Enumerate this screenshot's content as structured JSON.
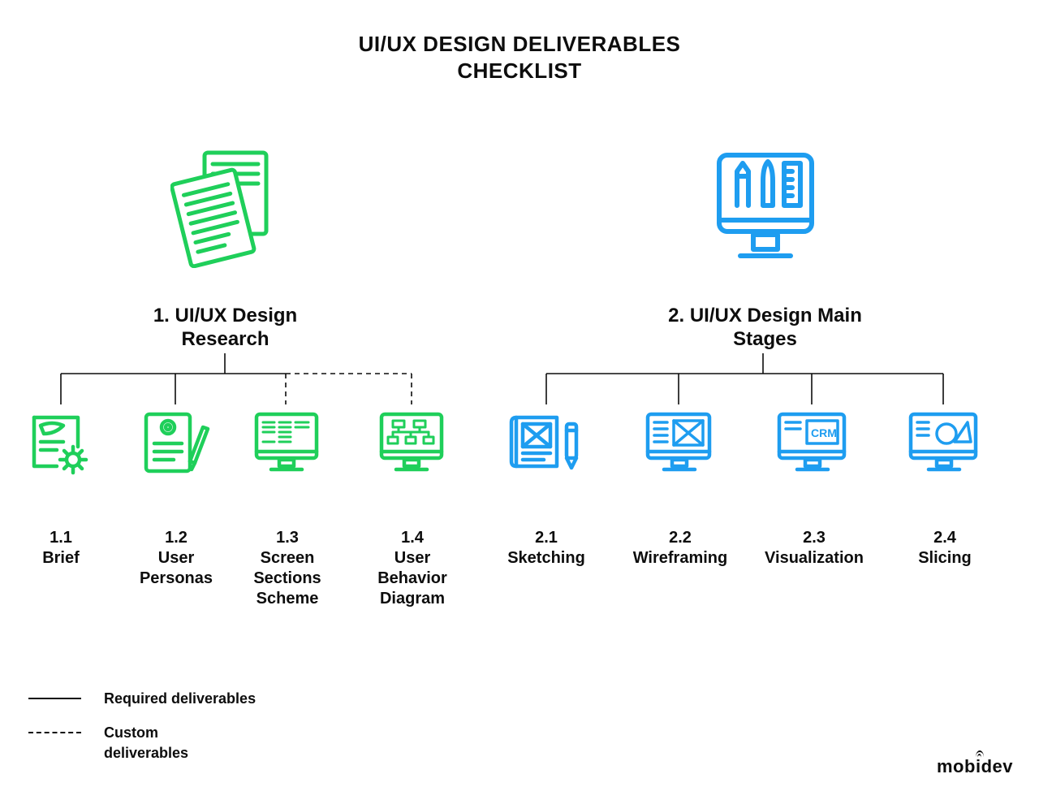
{
  "title_line1": "UI/UX DESIGN DELIVERABLES",
  "title_line2": "CHECKLIST",
  "legend": {
    "required": "Required deliverables",
    "custom_line1": "Custom",
    "custom_line2": "deliverables"
  },
  "colors": {
    "green": "#1fcf5a",
    "blue": "#1e9df0",
    "black": "#0d0d0d"
  },
  "logo": "mobidev",
  "sections": [
    {
      "id": "research",
      "title_line1": "1. UI/UX Design",
      "title_line2": "Research",
      "icon": "documents-icon",
      "color": "green",
      "items": [
        {
          "num": "1.1",
          "label": "Brief",
          "icon": "brief-gear-icon",
          "link": "required"
        },
        {
          "num": "1.2",
          "label": "User\nPersonas",
          "icon": "persona-icon",
          "link": "required"
        },
        {
          "num": "1.3",
          "label": "Screen\nSections\nScheme",
          "icon": "screen-sections-icon",
          "link": "custom"
        },
        {
          "num": "1.4",
          "label": "User\nBehavior\nDiagram",
          "icon": "behavior-diagram-icon",
          "link": "custom"
        }
      ]
    },
    {
      "id": "main",
      "title_line1": "2. UI/UX Design Main",
      "title_line2": "Stages",
      "icon": "design-tools-icon",
      "color": "blue",
      "items": [
        {
          "num": "2.1",
          "label": "Sketching",
          "icon": "sketching-icon",
          "link": "required"
        },
        {
          "num": "2.2",
          "label": "Wireframing",
          "icon": "wireframing-icon",
          "link": "required"
        },
        {
          "num": "2.3",
          "label": "Visualization",
          "icon": "visualization-icon",
          "link": "required"
        },
        {
          "num": "2.4",
          "label": "Slicing",
          "icon": "slicing-icon",
          "link": "required"
        }
      ]
    }
  ]
}
